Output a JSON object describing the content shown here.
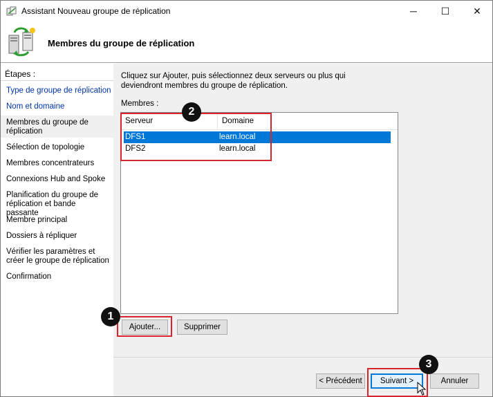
{
  "window": {
    "title": "Assistant Nouveau groupe de réplication",
    "icons": {
      "app": "replication-wizard-icon",
      "minimize": "minimize-icon",
      "maximize": "maximize-icon",
      "close": "close-icon"
    },
    "glyphs": {
      "minimize": "─",
      "maximize": "☐",
      "close": "✕"
    }
  },
  "header": {
    "title": "Membres du groupe de réplication",
    "icon": "replication-group-icon"
  },
  "sidebar": {
    "heading": "Étapes :",
    "steps": [
      {
        "label": "Type de groupe de réplication",
        "state": "link"
      },
      {
        "label": "Nom et domaine",
        "state": "link"
      },
      {
        "label": "Membres du groupe de réplication",
        "state": "current"
      },
      {
        "label": "Sélection de topologie",
        "state": "plain"
      },
      {
        "label": "Membres concentrateurs",
        "state": "plain"
      },
      {
        "label": "Connexions Hub and Spoke",
        "state": "plain"
      },
      {
        "label": "Planification du groupe de réplication et bande passante",
        "state": "plain"
      },
      {
        "label": "Membre principal",
        "state": "plain"
      },
      {
        "label": "Dossiers à répliquer",
        "state": "plain"
      },
      {
        "label": "Vérifier les paramètres et créer le groupe de réplication",
        "state": "plain"
      },
      {
        "label": "Confirmation",
        "state": "plain"
      }
    ]
  },
  "main": {
    "instructions": "Cliquez sur Ajouter, puis sélectionnez deux serveurs ou plus qui deviendront membres du groupe de réplication.",
    "members_label": "Membres :",
    "table": {
      "columns": [
        "Serveur",
        "Domaine"
      ],
      "rows": [
        {
          "server": "DFS1",
          "domain": "learn.local",
          "selected": true
        },
        {
          "server": "DFS2",
          "domain": "learn.local",
          "selected": false
        }
      ]
    },
    "buttons": {
      "add": "Ajouter...",
      "remove": "Supprimer"
    }
  },
  "footer": {
    "buttons": {
      "previous": "< Précédent",
      "next": "Suivant >",
      "cancel": "Annuler"
    }
  },
  "annotations": {
    "callouts": [
      "1",
      "2",
      "3"
    ],
    "color": "#d9232d"
  },
  "colors": {
    "selection": "#0078d7",
    "link": "#0033aa",
    "panel": "#f0f0f0"
  }
}
